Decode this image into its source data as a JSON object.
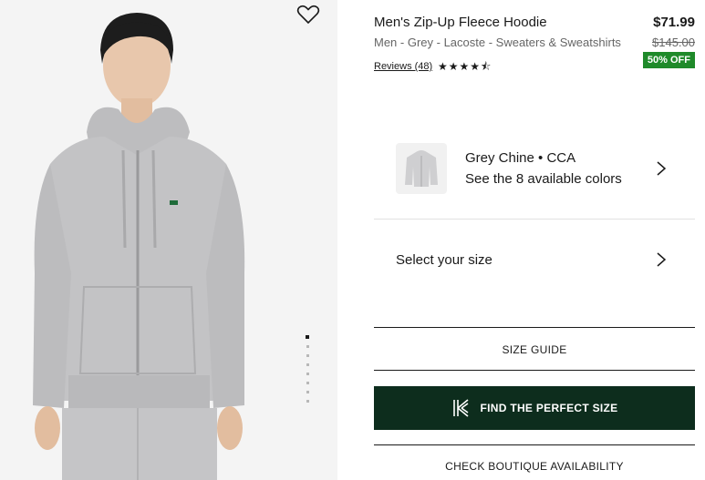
{
  "product": {
    "title": "Men's Zip-Up Fleece Hoodie",
    "price": "$71.99",
    "meta": "Men - Grey - Lacoste - Sweaters & Sweatshirts",
    "old_price": "$145.00",
    "reviews_label": "Reviews (48)",
    "rating": 4.5,
    "discount_badge": "50% OFF",
    "stars_text": "★★★★⯪"
  },
  "color": {
    "name": "Grey Chine • CCA",
    "sub": "See the 8 available colors"
  },
  "size": {
    "label": "Select your size"
  },
  "buttons": {
    "size_guide": "SIZE GUIDE",
    "perfect_size": "FIND THE PERFECT SIZE",
    "boutique": "CHECK BOUTIQUE AVAILABILITY"
  },
  "gallery": {
    "image_count": 8,
    "active_index": 0
  },
  "colors": {
    "accent": "#0d2d1d",
    "discount": "#1f8a2a"
  },
  "icons": {
    "wishlist": "heart-icon",
    "chevron": "chevron-right-icon",
    "fit_logo": "kiwi-size-logo-icon"
  }
}
